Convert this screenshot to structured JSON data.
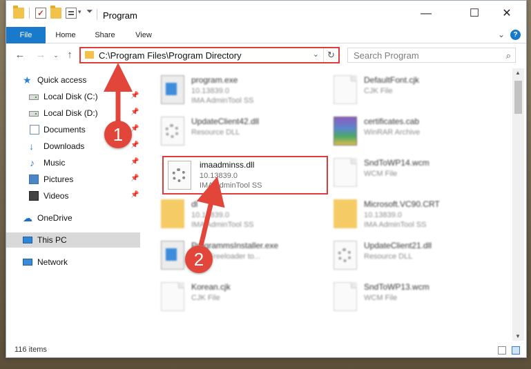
{
  "window": {
    "title": "Program",
    "controls": {
      "minimize": "—",
      "maximize": "☐",
      "close": "✕"
    }
  },
  "ribbon": {
    "tabs": [
      "File",
      "Home",
      "Share",
      "View"
    ],
    "help": "?"
  },
  "address": {
    "path": "C:\\Program Files\\Program Directory",
    "search_placeholder": "Search Program"
  },
  "sidebar": {
    "items": [
      {
        "label": "Quick access",
        "icon": "star-icon",
        "pinned": false
      },
      {
        "label": "Local Disk (C:)",
        "icon": "disk-icon",
        "pinned": true
      },
      {
        "label": "Local Disk (D:)",
        "icon": "disk-icon",
        "pinned": true
      },
      {
        "label": "Documents",
        "icon": "document-icon",
        "pinned": true
      },
      {
        "label": "Downloads",
        "icon": "download-icon",
        "pinned": true
      },
      {
        "label": "Music",
        "icon": "music-icon",
        "pinned": true
      },
      {
        "label": "Pictures",
        "icon": "pictures-icon",
        "pinned": true
      },
      {
        "label": "Videos",
        "icon": "videos-icon",
        "pinned": true
      },
      {
        "label": "OneDrive",
        "icon": "cloud-icon",
        "pinned": false
      },
      {
        "label": "This PC",
        "icon": "computer-icon",
        "pinned": false,
        "selected": true
      },
      {
        "label": "Network",
        "icon": "network-icon",
        "pinned": false
      }
    ]
  },
  "files": [
    {
      "name": "program.exe",
      "line2": "10.13839.0",
      "line3": "IMA AdminTool SS",
      "icon": "exe-icon"
    },
    {
      "name": "DefaultFont.cjk",
      "line2": "CJK File",
      "line3": "",
      "icon": "page-icon"
    },
    {
      "name": "UpdateClient42.dll",
      "line2": "Resource DLL",
      "line3": "",
      "icon": "gear-page-icon"
    },
    {
      "name": "certificates.cab",
      "line2": "WinRAR Archive",
      "line3": "",
      "icon": "archive-icon"
    },
    {
      "name": "imaadminss.dll",
      "line2": "10.13839.0",
      "line3": "IMA AdminTool SS",
      "icon": "gear-page-icon",
      "highlighted": true
    },
    {
      "name": "SndToWP14.wcm",
      "line2": "WCM File",
      "line3": "",
      "icon": "page-icon"
    },
    {
      "name": "dl",
      "line2": "10.13839.0",
      "line3": "IMA AdminTool SS",
      "icon": "folder-icon"
    },
    {
      "name": "Microsoft.VC90.CRT",
      "line2": "10.13839.0",
      "line3": "IMA AdminTool SS",
      "icon": "folder-icon"
    },
    {
      "name": "ProgrammsInstaller.exe",
      "line2": "CSY Freeloader to...",
      "line3": "",
      "icon": "exe-icon"
    },
    {
      "name": "UpdateClient21.dll",
      "line2": "Resource DLL",
      "line3": "",
      "icon": "gear-page-icon"
    },
    {
      "name": "Korean.cjk",
      "line2": "CJK File",
      "line3": "",
      "icon": "page-icon"
    },
    {
      "name": "SndToWP13.wcm",
      "line2": "WCM File",
      "line3": "",
      "icon": "page-icon"
    }
  ],
  "status": {
    "count": "116 items"
  },
  "annotations": {
    "step1": "1",
    "step2": "2"
  },
  "colors": {
    "accent": "#1979ca",
    "highlight": "#e03a3a"
  }
}
